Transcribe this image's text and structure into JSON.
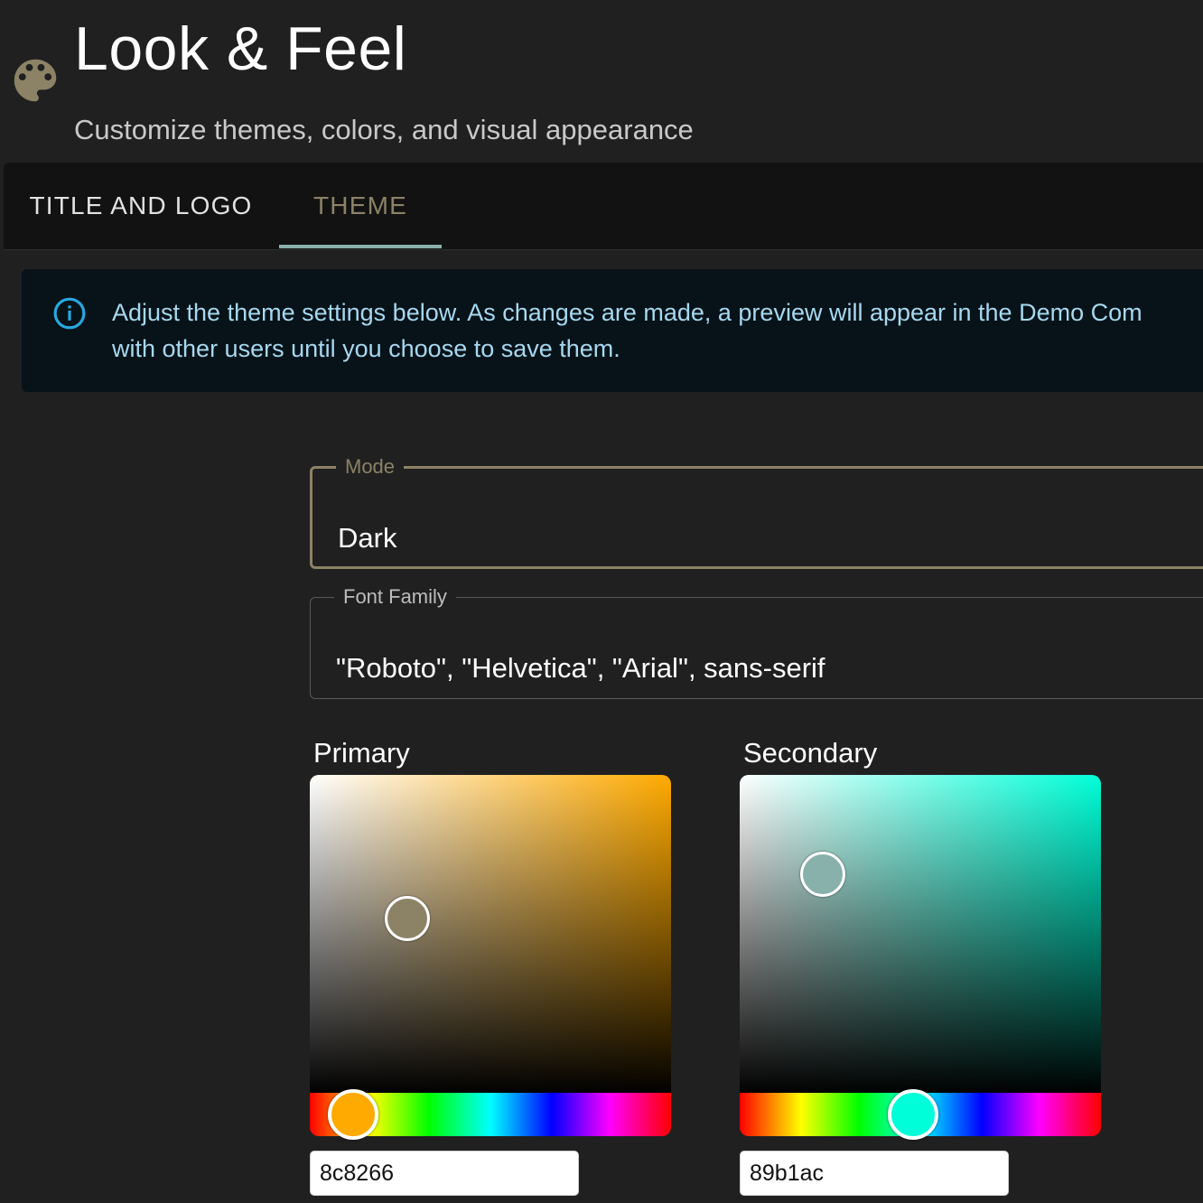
{
  "header": {
    "title": "Look & Feel",
    "subtitle": "Customize themes, colors, and visual appearance",
    "icon": "palette-icon",
    "icon_color": "#8c8266"
  },
  "tabs": [
    {
      "label": "TITLE AND LOGO",
      "active": false
    },
    {
      "label": "THEME",
      "active": true
    }
  ],
  "tab_colors": {
    "active_text": "#8c8266",
    "indicator": "#89b1ac"
  },
  "info_alert": {
    "icon": "info-icon",
    "line1": "Adjust the theme settings below. As changes are made, a preview will appear in the Demo Com",
    "line2": "with other users until you choose to save them.",
    "text_color": "#a7d8f0",
    "icon_color": "#29a8e0"
  },
  "fields": {
    "mode": {
      "label": "Mode",
      "value": "Dark"
    },
    "font_family": {
      "label": "Font Family",
      "value": "\"Roboto\", \"Helvetica\", \"Arial\", sans-serif"
    }
  },
  "pickers": {
    "primary": {
      "label": "Primary",
      "hex": "8c8266",
      "hue_color": "#ffaa00",
      "saturation": 0.27,
      "value": 0.55,
      "hue_fraction": 0.12
    },
    "secondary": {
      "label": "Secondary",
      "hex": "89b1ac",
      "hue_color": "#00ffd8",
      "saturation": 0.23,
      "value": 0.69,
      "hue_fraction": 0.48
    }
  }
}
